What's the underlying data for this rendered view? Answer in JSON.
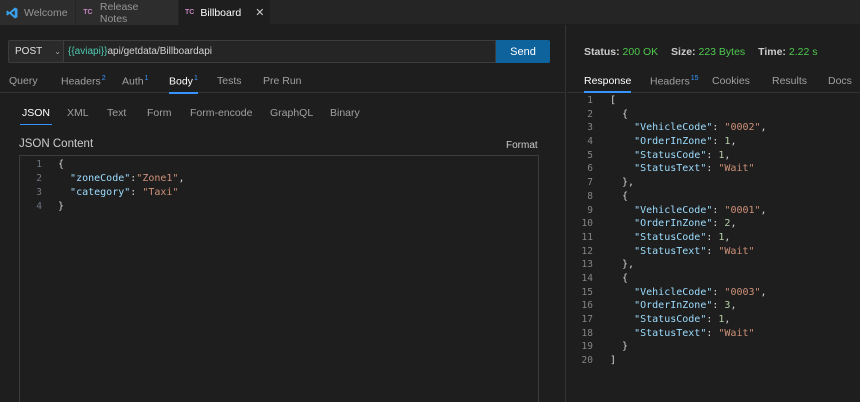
{
  "tabs": [
    {
      "label": "Welcome",
      "icon": "vscode-icon"
    },
    {
      "label": "Release Notes",
      "badge": "TC"
    },
    {
      "label": "Billboard",
      "badge": "TC",
      "close": "✕"
    }
  ],
  "request": {
    "method": "POST",
    "method_chevron": "⌄",
    "url_var": "{{aviapi}}",
    "url_path": "api/getdata/Billboardapi",
    "send_label": "Send"
  },
  "request_tabs": [
    {
      "label": "Query"
    },
    {
      "label": "Headers",
      "count": "2"
    },
    {
      "label": "Auth",
      "count": "1"
    },
    {
      "label": "Body",
      "count": "1"
    },
    {
      "label": "Tests"
    },
    {
      "label": "Pre Run"
    }
  ],
  "body_tabs": [
    "JSON",
    "XML",
    "Text",
    "Form",
    "Form-encode",
    "GraphQL",
    "Binary"
  ],
  "json_content": {
    "heading": "JSON Content",
    "format_label": "Format",
    "line_numbers": [
      "1",
      "2",
      "3",
      "4"
    ],
    "lines": [
      {
        "t": "{"
      },
      {
        "indent": "  ",
        "key": "\"zoneCode\"",
        "sep": ":",
        "str": "\"Zone1\"",
        "end": ","
      },
      {
        "indent": "  ",
        "key": "\"category\"",
        "sep": ": ",
        "str": "\"Taxi\"",
        "end": ""
      },
      {
        "t": "}"
      }
    ]
  },
  "response_status": {
    "status_label": "Status:",
    "status_value": "200 OK",
    "size_label": "Size:",
    "size_value": "223 Bytes",
    "time_label": "Time:",
    "time_value": "2.22 s"
  },
  "response_tabs": [
    {
      "label": "Response"
    },
    {
      "label": "Headers",
      "count": "15"
    },
    {
      "label": "Cookies"
    },
    {
      "label": "Results"
    },
    {
      "label": "Docs"
    }
  ],
  "response_body": {
    "line_numbers": [
      "1",
      "2",
      "3",
      "4",
      "5",
      "6",
      "7",
      "8",
      "9",
      "10",
      "11",
      "12",
      "13",
      "14",
      "15",
      "16",
      "17",
      "18",
      "19",
      "20"
    ],
    "items": [
      {
        "VehicleCode": "\"0002\"",
        "OrderInZone": "1",
        "StatusCode": "1",
        "StatusText": "\"Wait\""
      },
      {
        "VehicleCode": "\"0001\"",
        "OrderInZone": "2",
        "StatusCode": "1",
        "StatusText": "\"Wait\""
      },
      {
        "VehicleCode": "\"0003\"",
        "OrderInZone": "3",
        "StatusCode": "1",
        "StatusText": "\"Wait\""
      }
    ]
  }
}
